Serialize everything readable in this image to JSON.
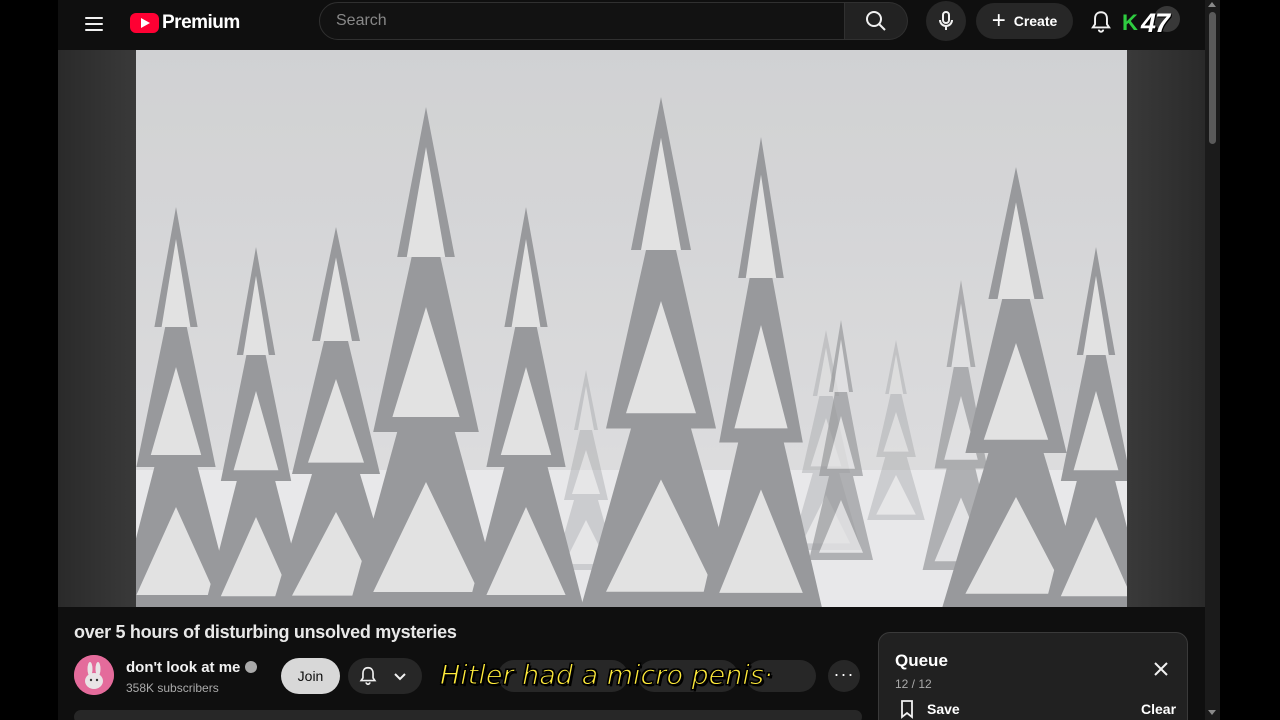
{
  "header": {
    "logo_text": "Premium",
    "search_placeholder": "Search",
    "create_label": "Create",
    "channel_logo_letter": "K",
    "channel_logo_number": "47"
  },
  "video": {
    "title": "over 5 hours of disturbing unsolved mysteries",
    "caption": "Hitler had a micro penis·"
  },
  "channel": {
    "name": "don't look at me",
    "subscribers": "358K subscribers",
    "join_label": "Join"
  },
  "queue": {
    "title": "Queue",
    "count": "12 / 12",
    "save_label": "Save",
    "clear_label": "Clear"
  },
  "colors": {
    "background": "#0f0f0f",
    "brand_red": "#ff0033",
    "caption_yellow": "#ffeb3b",
    "logo_green": "#2ecc40"
  },
  "icons": [
    "menu-icon",
    "youtube-logo-icon",
    "search-icon",
    "mic-icon",
    "plus-icon",
    "bell-icon",
    "verified-icon",
    "chevron-down-icon",
    "more-icon",
    "close-icon",
    "bookmark-icon"
  ]
}
